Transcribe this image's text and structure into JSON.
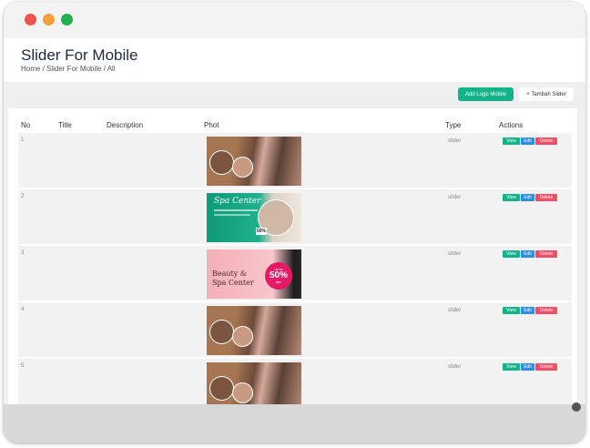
{
  "window": {
    "controls": [
      "close",
      "minimize",
      "maximize"
    ]
  },
  "header": {
    "title": "Slider For Mobile",
    "breadcrumb": "Home  /  Slider For Mobile / All"
  },
  "toolbar": {
    "add_logo_label": "Add Logo Mobile",
    "tambah_label": "+ Tambah Slider"
  },
  "table": {
    "columns": {
      "no": "No",
      "title": "Title",
      "description": "Description",
      "photo": "Phot",
      "type": "Type",
      "actions": "Actions"
    },
    "rows": [
      {
        "no": "1",
        "title": "",
        "description": "",
        "photo": "massage",
        "type": "slider"
      },
      {
        "no": "2",
        "title": "",
        "description": "",
        "photo": "spa-center",
        "type": "slider"
      },
      {
        "no": "3",
        "title": "",
        "description": "",
        "photo": "beauty-spa",
        "type": "slider"
      },
      {
        "no": "4",
        "title": "",
        "description": "",
        "photo": "massage",
        "type": "slider"
      },
      {
        "no": "5",
        "title": "",
        "description": "",
        "photo": "massage",
        "type": "slider"
      }
    ],
    "actions": {
      "view": "View",
      "edit": "Edit",
      "delete": "Delete"
    }
  },
  "banners": {
    "spa_title": "Spa Center",
    "spa_discount": "50%",
    "beauty_line1": "Beauty &",
    "beauty_line2": "Spa Center",
    "beauty_upto": "UP TO",
    "beauty_pct": "50%",
    "beauty_off": "OFF"
  },
  "colors": {
    "add_button": "#12b38a",
    "view": "#12b38a",
    "edit": "#2d8ce3",
    "delete": "#ee4f67"
  }
}
